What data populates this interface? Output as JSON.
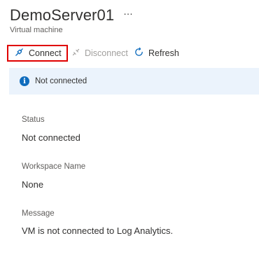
{
  "header": {
    "title": "DemoServer01",
    "more": "…",
    "subtitle": "Virtual machine"
  },
  "toolbar": {
    "connect_label": "Connect",
    "disconnect_label": "Disconnect",
    "refresh_label": "Refresh"
  },
  "banner": {
    "icon": "info-icon",
    "text": "Not connected"
  },
  "fields": {
    "status": {
      "label": "Status",
      "value": "Not connected"
    },
    "workspace": {
      "label": "Workspace Name",
      "value": "None"
    },
    "message": {
      "label": "Message",
      "value": "VM is not connected to Log Analytics."
    }
  },
  "colors": {
    "accent": "#0f6cbd",
    "highlight": "#e00000",
    "banner_bg": "#ebf3fc"
  }
}
